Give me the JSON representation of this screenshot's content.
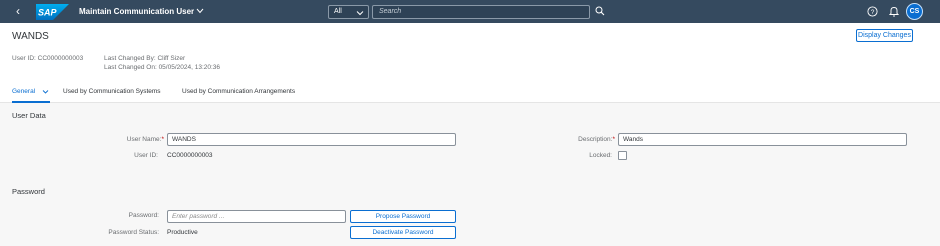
{
  "shell": {
    "logo_text": "SAP",
    "app_title": "Maintain Communication User",
    "search_scope": "All",
    "search_placeholder": "Search",
    "avatar_initials": "CS",
    "bar_color": "#354a5f"
  },
  "header": {
    "object_title": "WANDS",
    "display_changes_label": "Display Changes",
    "user_id_line": "User ID: CC0000000003",
    "last_changed_by": "Last Changed By: Cliff Sizer",
    "last_changed_on": "Last Changed On: 05/05/2024, 13:20:36"
  },
  "tabs": [
    {
      "label": "General",
      "active": true
    },
    {
      "label": "Used by Communication Systems",
      "active": false
    },
    {
      "label": "Used by Communication Arrangements",
      "active": false
    }
  ],
  "user_data": {
    "section_title": "User Data",
    "user_name_label": "User Name:",
    "user_name_value": "WANDS",
    "user_id_label": "User ID:",
    "user_id_value": "CC0000000003",
    "description_label": "Description:",
    "description_value": "Wands",
    "locked_label": "Locked:",
    "locked": false
  },
  "password": {
    "section_title": "Password",
    "password_label": "Password:",
    "password_placeholder": "Enter password ...",
    "propose_label": "Propose Password",
    "status_label": "Password Status:",
    "status_value": "Productive",
    "deactivate_label": "Deactivate Password"
  },
  "colors": {
    "accent": "#0a6ed1",
    "required": "#bb0000"
  }
}
